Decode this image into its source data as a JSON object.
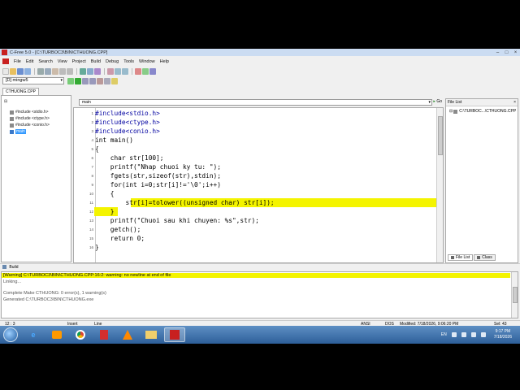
{
  "window": {
    "title": "C-Free 5.0 - [C:\\TURBOC3\\BIN\\CTHUONG.CPP]",
    "controls": [
      "–",
      "□",
      "×"
    ]
  },
  "menu": [
    "File",
    "Edit",
    "Search",
    "View",
    "Project",
    "Build",
    "Debug",
    "Tools",
    "Window",
    "Help"
  ],
  "toolbar": {
    "compiler_combo": "[D] mingw5"
  },
  "workspace": {
    "tab_label": "CTHUONG.CPP",
    "tree": [
      {
        "label": "#include <stdio.h>",
        "kind": "include"
      },
      {
        "label": "#include <ctype.h>",
        "kind": "include"
      },
      {
        "label": "#include <conio.h>",
        "kind": "include"
      },
      {
        "label": "main",
        "kind": "function"
      }
    ]
  },
  "editor": {
    "function_combo": "main",
    "go_label": "Go",
    "lines": [
      {
        "n": "1",
        "text": "#include<stdio.h>"
      },
      {
        "n": "2",
        "text": "#include<ctype.h>"
      },
      {
        "n": "3",
        "text": "#include<conio.h>"
      },
      {
        "n": "4",
        "text": "int main()"
      },
      {
        "n": "5",
        "text": "{"
      },
      {
        "n": "6",
        "text": "    char str[100];"
      },
      {
        "n": "7",
        "text": "    printf(\"Nhap chuoi ky tu: \");"
      },
      {
        "n": "8",
        "text": "    fgets(str,sizeof(str),stdin);"
      },
      {
        "n": "9",
        "text": "    for(int i=0;str[i]!='\\0';i++)"
      },
      {
        "n": "10",
        "text": "    {"
      },
      {
        "n": "11",
        "text": "        str[i]=tolower((unsigned char) str[i]);"
      },
      {
        "n": "12",
        "text": "    }"
      },
      {
        "n": "13",
        "text": "    printf(\"Chuoi sau khi chuyen: %s\",str);"
      },
      {
        "n": "14",
        "text": "    getch();"
      },
      {
        "n": "15",
        "text": "    return 0;"
      },
      {
        "n": "16",
        "text": "}"
      }
    ],
    "highlight_color": "#f4f400"
  },
  "file_list": {
    "title": "File List",
    "close": "×",
    "items": [
      "C:\\TURBOC...\\CTHUONG.CPP"
    ],
    "tabs": [
      "File List",
      "Class"
    ]
  },
  "build": {
    "title": "Build",
    "lines": [
      "[Warning] C:\\TURBOC3\\BIN\\CTHUONG.CPP:16:2: warning: no newline at end of file",
      "Linking...",
      "",
      "Complete Make CTHUONG: 0 error(s), 1 warning(s)",
      "Generated C:\\TURBOC3\\BIN\\CTHUONG.exe"
    ]
  },
  "status": {
    "position": "12 : 3",
    "insert": "Insert",
    "line": "Line",
    "encoding": "ANSI",
    "eol": "DOS",
    "modified": "Modified: 7/18/2026, 9:06:20 PM",
    "sel": "Sel: 43"
  },
  "taskbar": {
    "apps": [
      "ie",
      "media",
      "chrome",
      "pdf",
      "vlc",
      "explorer",
      "cfree"
    ],
    "lang": "EN",
    "time": "9:17 PM",
    "date": "7/18/2026"
  }
}
